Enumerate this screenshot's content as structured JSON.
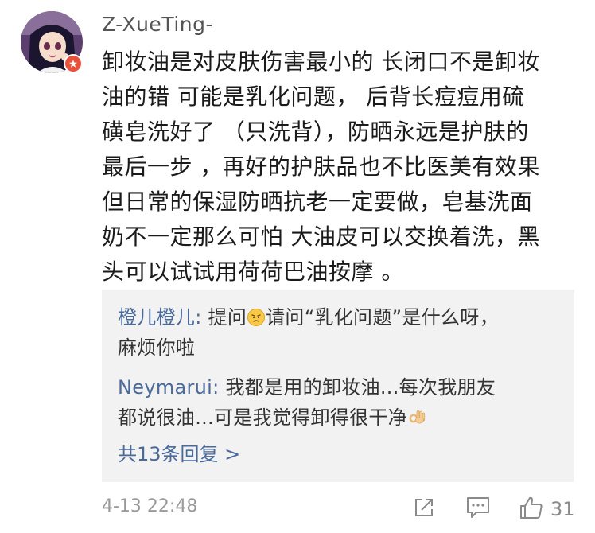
{
  "comment": {
    "username": "Z-XueTing-",
    "avatar": "anime-girl-avatar",
    "badge": "red-badge-icon",
    "content_lines": [
      "卸妆油是对皮肤伤害最小的 长闭口不是卸妆",
      "油的错 可能是乳化问题，   后背长痘痘用硫",
      "磺皂洗好了 （只洗背），防晒永远是护肤的",
      "最后一步 ，再好的护肤品也不比医美有效果",
      "但日常的保湿防晒抗老一定要做，皂基洗面",
      "奶不一定那么可怕 大油皮可以交换着洗，黑",
      "头可以试试用荷荷巴油按摩 。"
    ],
    "timestamp": "4-13 22:48",
    "like_count": "31"
  },
  "replies": [
    {
      "nick": "橙儿橙儿:",
      "line1_before_emoji": " 提问",
      "emoji": "worried-face-emoji",
      "line1_after_emoji": "请问“乳化问题”是什么呀，",
      "line2": "麻烦你啦"
    },
    {
      "nick": "Neymarui:",
      "line1": " 我都是用的卸妆油...每次我朋友",
      "line2_before_emoji": "都说很油...可是我觉得卸得很干净",
      "emoji": "ok-hand-emoji"
    }
  ],
  "more_replies_label": "共13条回复 >",
  "colors": {
    "link": "#4a6a9c",
    "reply_bg": "#f2f2f2",
    "badge": "#e8503a",
    "meta": "#9a9a9a"
  }
}
